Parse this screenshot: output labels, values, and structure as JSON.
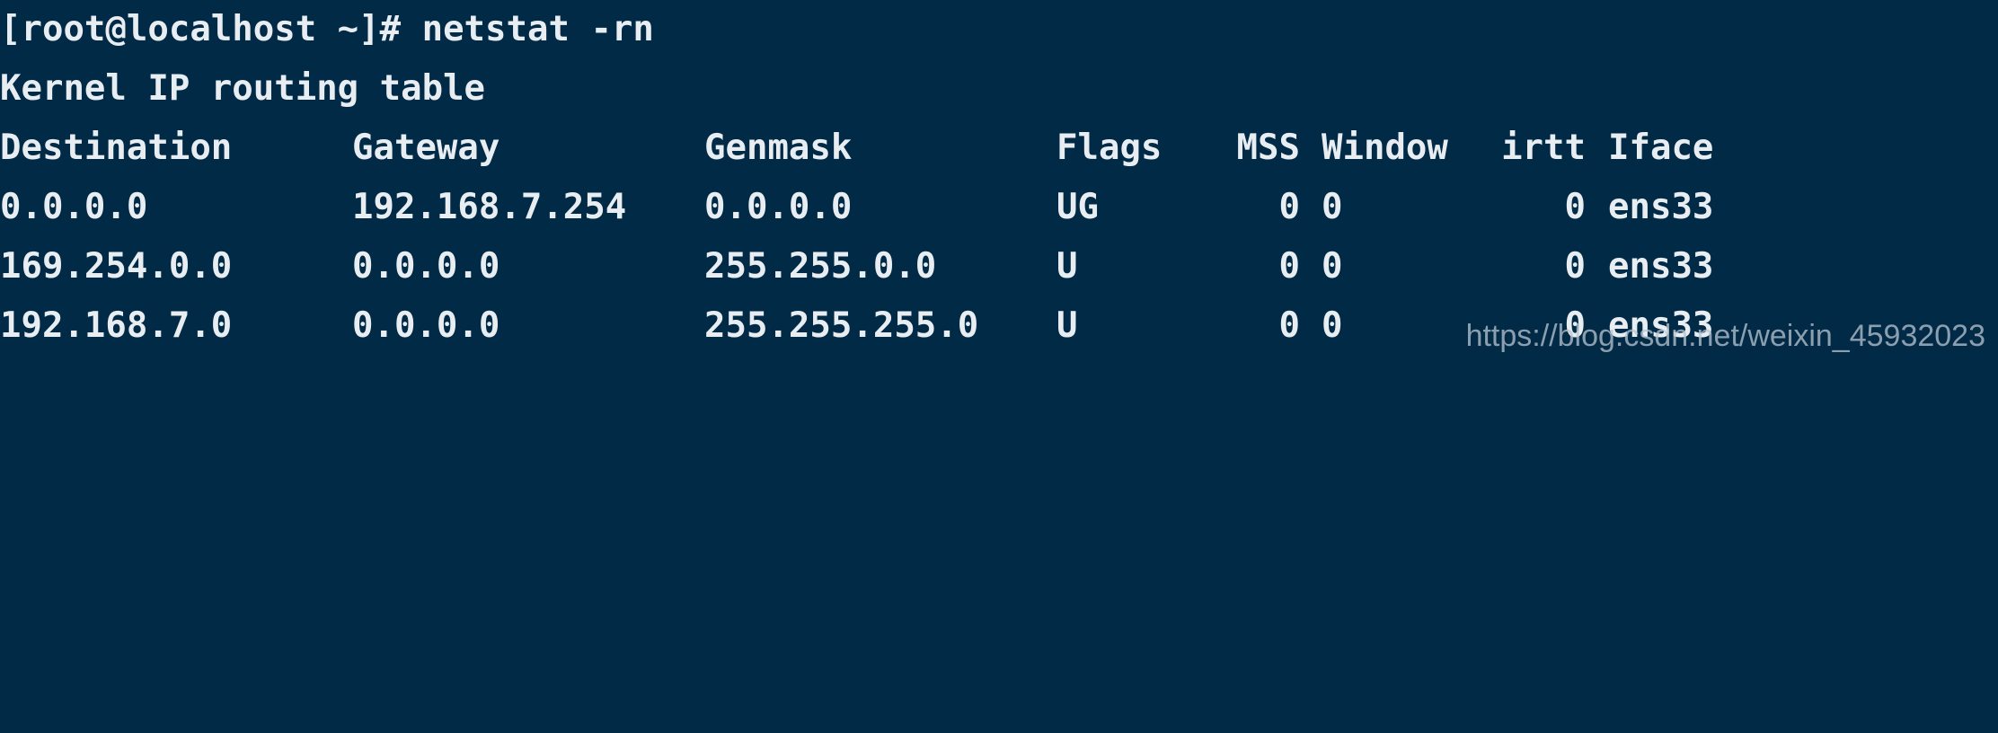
{
  "terminal": {
    "prompt": "[root@localhost ~]# netstat -rn",
    "title": "Kernel IP routing table",
    "headers": {
      "destination": "Destination",
      "gateway": "Gateway",
      "genmask": "Genmask",
      "flags": "Flags",
      "mss": "MSS",
      "window": "Window",
      "irtt": "irtt",
      "iface": "Iface"
    },
    "rows": [
      {
        "destination": "0.0.0.0",
        "gateway": "192.168.7.254",
        "genmask": "0.0.0.0",
        "flags": "UG",
        "mss": "0",
        "window": "0",
        "irtt": "0",
        "iface": "ens33"
      },
      {
        "destination": "169.254.0.0",
        "gateway": "0.0.0.0",
        "genmask": "255.255.0.0",
        "flags": "U",
        "mss": "0",
        "window": "0",
        "irtt": "0",
        "iface": "ens33"
      },
      {
        "destination": "192.168.7.0",
        "gateway": "0.0.0.0",
        "genmask": "255.255.255.0",
        "flags": "U",
        "mss": "0",
        "window": "0",
        "irtt": "0",
        "iface": "ens33"
      }
    ]
  },
  "watermark": "https://blog.csdn.net/weixin_45932023",
  "colors": {
    "background": "#012a47",
    "text": "#e8edf2"
  }
}
